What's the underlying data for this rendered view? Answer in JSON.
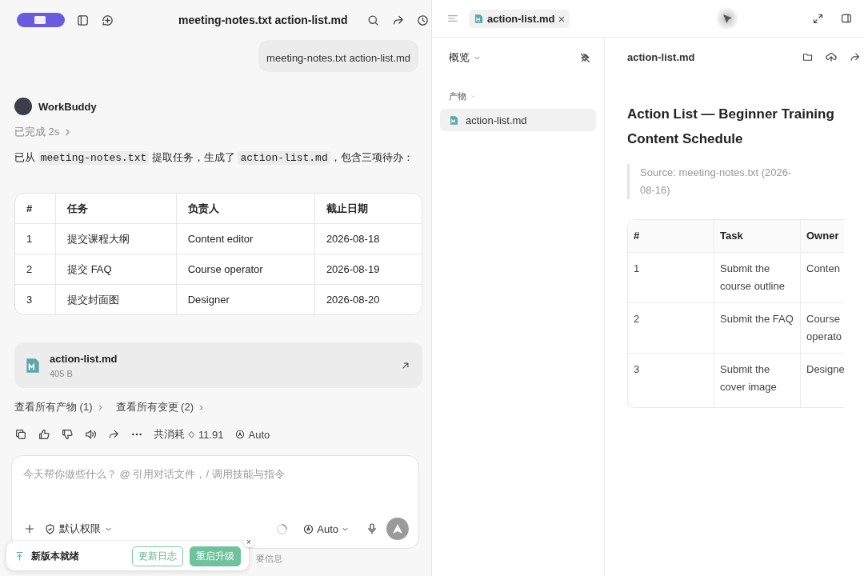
{
  "chat": {
    "title": "meeting-notes.txt action-list.md",
    "user_message": "meeting-notes.txt action-list.md",
    "assistant": {
      "name": "WorkBuddy",
      "status": "已完成 2s",
      "message_parts": [
        {
          "kind": "text",
          "text": "已从 "
        },
        {
          "kind": "code",
          "text": "meeting-notes.txt"
        },
        {
          "kind": "text",
          "text": " 提取任务，生成了 "
        },
        {
          "kind": "code",
          "text": "action-list.md"
        },
        {
          "kind": "text",
          "text": "，包含三项待办："
        }
      ]
    },
    "table": {
      "columns": [
        "#",
        "任务",
        "负责人",
        "截止日期"
      ],
      "rows": [
        [
          "1",
          "提交课程大纲",
          "Content editor",
          "2026-08-18"
        ],
        [
          "2",
          "提交 FAQ",
          "Course operator",
          "2026-08-19"
        ],
        [
          "3",
          "提交封面图",
          "Designer",
          "2026-08-20"
        ]
      ]
    },
    "file_card": {
      "name": "action-list.md",
      "size": "405 B"
    },
    "links": [
      "查看所有产物 (1)",
      "查看所有变更 (2)"
    ],
    "usage": {
      "label": "共消耗",
      "amount": "11.91",
      "model": "Auto"
    },
    "composer": {
      "placeholder": "今天帮你做些什么？ @ 引用对话文件，/ 调用技能与指令",
      "permission": "默认权限",
      "model": "Auto"
    },
    "footer_note": "要信息",
    "toast": {
      "message": "新版本就绪",
      "buttons": [
        "更新日志",
        "重启升级"
      ],
      "close": "×"
    }
  },
  "preview": {
    "tab": {
      "label": "action-list.md",
      "close": "×"
    },
    "sidebar": {
      "overview": "概览",
      "section": "产物",
      "items": [
        {
          "label": "action-list.md",
          "selected": true
        }
      ]
    },
    "document": {
      "filename": "action-list.md",
      "title": "Action List — Beginner Training Content Schedule",
      "quote": "Source: meeting-notes.txt (2026-08-16)",
      "table": {
        "columns": [
          "#",
          "Task",
          "Owner"
        ],
        "rows": [
          [
            "1",
            "Submit the course outline",
            "Conten"
          ],
          [
            "2",
            "Submit the FAQ",
            "Course operato"
          ],
          [
            "3",
            "Submit the cover image",
            "Designe"
          ]
        ]
      }
    }
  }
}
